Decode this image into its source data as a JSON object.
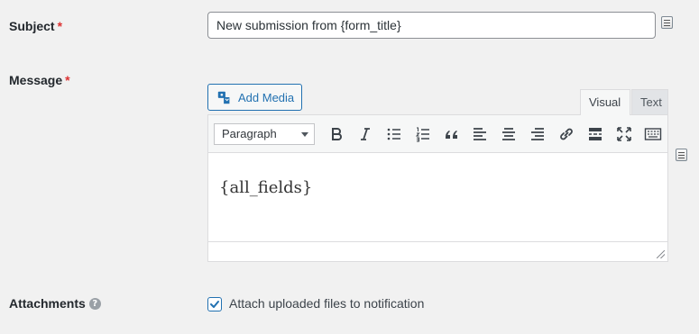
{
  "subject": {
    "label": "Subject",
    "required_marker": "*",
    "value": "New submission from {form_title}"
  },
  "message": {
    "label": "Message",
    "required_marker": "*",
    "add_media_label": "Add Media",
    "tabs": [
      {
        "label": "Visual",
        "active": true
      },
      {
        "label": "Text",
        "active": false
      }
    ],
    "format_select": "Paragraph",
    "toolbar_icons": [
      "bold-icon",
      "italic-icon",
      "bullet-list-icon",
      "numbered-list-icon",
      "blockquote-icon",
      "align-left-icon",
      "align-center-icon",
      "align-right-icon",
      "link-icon",
      "read-more-icon",
      "fullscreen-icon",
      "toolbar-toggle-icon"
    ],
    "content": "{all_fields}"
  },
  "attachments": {
    "label": "Attachments",
    "help_icon": "?",
    "checkbox_label": "Attach uploaded files to notification",
    "checked": true
  },
  "colors": {
    "accent": "#2271b1",
    "required": "#dc3232",
    "background": "#f1f1f1"
  }
}
